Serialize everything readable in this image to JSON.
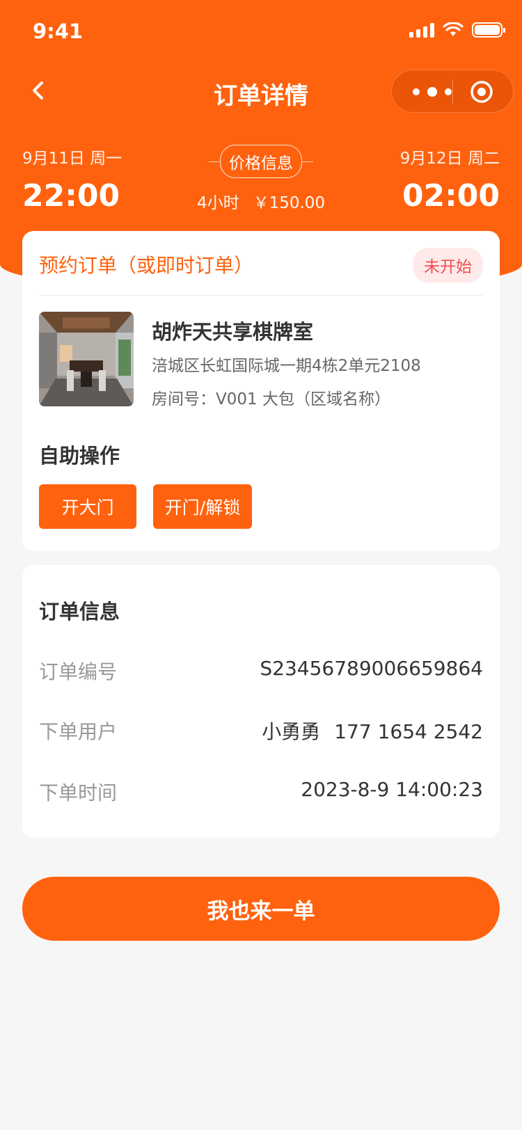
{
  "status_bar": {
    "time": "9:41"
  },
  "nav": {
    "title": "订单详情"
  },
  "schedule": {
    "start_date": "9月11日 周一",
    "start_time": "22:00",
    "end_date": "9月12日 周二",
    "end_time": "02:00",
    "price_label": "价格信息",
    "duration": "4小时",
    "price": "￥150.00"
  },
  "order_card": {
    "type": "预约订单（或即时订单）",
    "status": "未开始",
    "shop_name": "胡炸天共享棋牌室",
    "address": "涪城区长虹国际城一期4栋2单元2108",
    "room": "房间号：V001 大包（区域名称）",
    "self_service_title": "自助操作",
    "buttons": {
      "open_gate": "开大门",
      "unlock": "开门/解锁"
    }
  },
  "order_info": {
    "title": "订单信息",
    "rows": [
      {
        "key": "订单编号",
        "value": "S234567890066598​64"
      },
      {
        "key": "下单用户",
        "value_name": "小勇勇",
        "value_phone": "177 1654 2542"
      },
      {
        "key": "下单时间",
        "value": "2023-8-9 14:00:23"
      }
    ]
  },
  "cta": {
    "label": "我也来一单"
  },
  "colors": {
    "primary": "#ff620e",
    "badge_bg": "#ffeaea",
    "badge_text": "#f04e50",
    "page_bg": "#f6f6f6"
  }
}
